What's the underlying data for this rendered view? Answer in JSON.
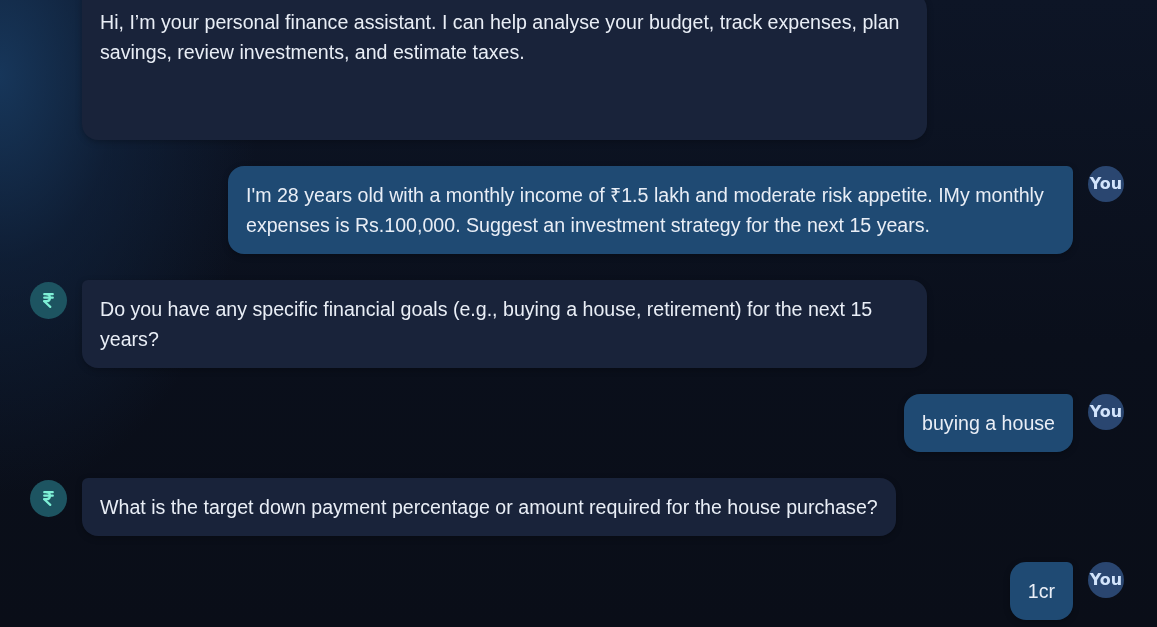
{
  "messages": [
    {
      "kind": "assistant",
      "avatar": false,
      "text": "Hi, I’m your personal finance assistant. I can help analyse your budget, track expenses, plan savings, review investments, and estimate taxes."
    },
    {
      "kind": "user",
      "avatar": true,
      "avatar_label": "You",
      "text": "I'm 28 years old with a monthly income of ₹1.5 lakh and moderate risk appetite. IMy monthly expenses is Rs.100,000. Suggest an investment strategy for the next 15 years."
    },
    {
      "kind": "assistant",
      "avatar": true,
      "text": "Do you have any specific financial goals (e.g., buying a house, retirement) for the next 15 years?"
    },
    {
      "kind": "user",
      "avatar": true,
      "avatar_label": "You",
      "text": "buying a house"
    },
    {
      "kind": "assistant",
      "avatar": true,
      "text": "What is the target down payment percentage or amount required for the house purchase?"
    },
    {
      "kind": "user",
      "avatar": true,
      "avatar_label": "You",
      "text": "1cr"
    }
  ]
}
